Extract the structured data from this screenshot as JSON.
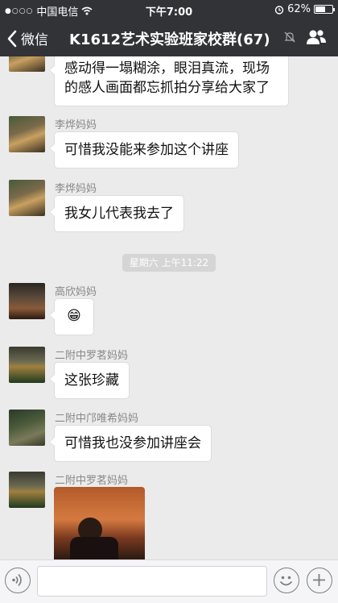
{
  "status_bar": {
    "carrier": "中国电信",
    "time": "下午7:00",
    "battery": "62%",
    "battery_level": 0.62
  },
  "nav": {
    "back_label": "微信",
    "title": "K1612艺术实验班家校群(67)"
  },
  "messages": [
    {
      "sender": "",
      "text_lines": [
        "感动得一塌糊涂，眼泪真流，现场",
        "的感人画面都忘抓拍分享给大家了"
      ]
    },
    {
      "sender": "李烨妈妈",
      "text": "可惜我没能来参加这个讲座"
    },
    {
      "sender": "李烨妈妈",
      "text": "我女儿代表我去了"
    },
    {
      "sender": "高欣妈妈",
      "text": "😁"
    },
    {
      "sender": "二附中罗茗妈妈",
      "text": "这张珍藏"
    },
    {
      "sender": "二附中邝唯希妈妈",
      "text": "可惜我也没参加讲座会"
    },
    {
      "sender": "二附中罗茗妈妈",
      "text": ""
    }
  ],
  "timestamp": "星期六 上午11:22",
  "input": {
    "value": ""
  },
  "icons": {
    "back": "chevron-left-icon",
    "mute": "bell-mute-icon",
    "group": "group-icon",
    "voice": "voice-icon",
    "emoji": "emoji-icon",
    "plus": "plus-icon"
  }
}
